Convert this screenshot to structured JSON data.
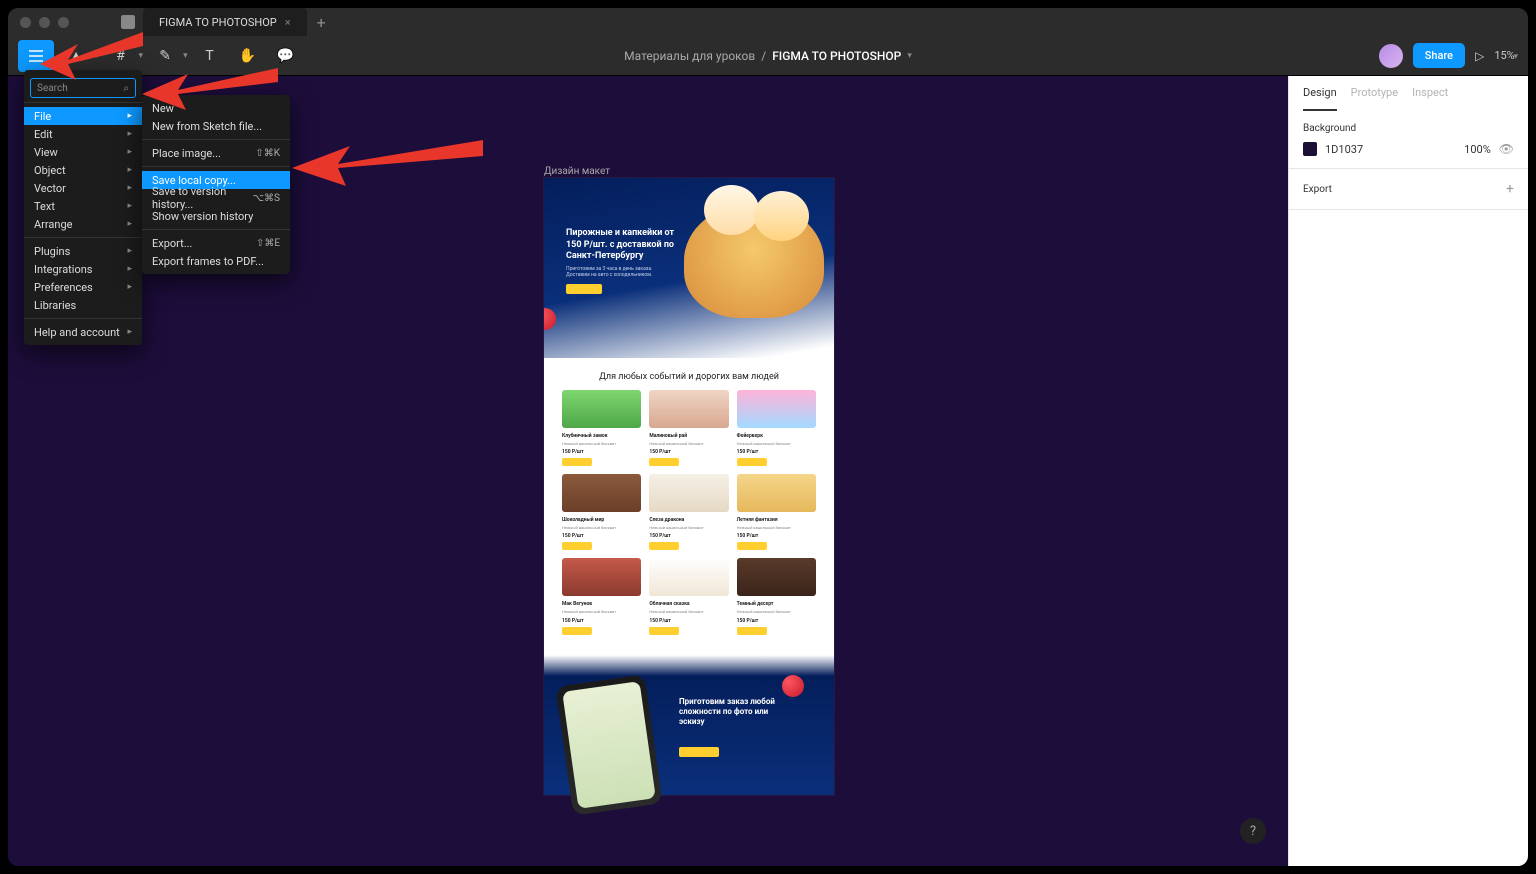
{
  "tab": {
    "title": "FIGMA TO PHOTOSHOP"
  },
  "breadcrumb": {
    "folder": "Материалы для уроков",
    "file": "FIGMA TO PHOTOSHOP"
  },
  "toolbar": {
    "share": "Share",
    "zoom": "15%"
  },
  "main_menu": {
    "search_placeholder": "Search",
    "items": [
      "File",
      "Edit",
      "View",
      "Object",
      "Vector",
      "Text",
      "Arrange"
    ],
    "items2": [
      "Plugins",
      "Integrations",
      "Preferences",
      "Libraries"
    ],
    "items3": [
      "Help and account"
    ]
  },
  "sub_menu": {
    "new": "New",
    "new_sketch": "New from Sketch file...",
    "place": "Place image...",
    "place_sc": "⇧⌘K",
    "save_local": "Save local copy...",
    "save_history": "Save to version history...",
    "save_history_sc": "⌥⌘S",
    "show_history": "Show version history",
    "export": "Export...",
    "export_sc": "⇧⌘E",
    "export_pdf": "Export frames to PDF..."
  },
  "right_panel": {
    "tabs": [
      "Design",
      "Prototype",
      "Inspect"
    ],
    "bg_label": "Background",
    "bg_hex": "1D1037",
    "bg_opacity": "100%",
    "export_label": "Export"
  },
  "canvas": {
    "frame_label": "Дизайн макет",
    "hero": {
      "title": "Пирожные и капкейки от 150 Р/шт. с доставкой по Санкт-Петербургу",
      "sub": "Приготовим за 3 часа в день заказа. Доставим на авто с холодильником."
    },
    "section_title": "Для любых событий и дорогих вам людей",
    "cards": [
      {
        "t": "Клубничный замок",
        "p": "150 Р/шт",
        "img": "linear-gradient(#7fd66f,#4ea848)"
      },
      {
        "t": "Малиновый рай",
        "p": "150 Р/шт",
        "img": "linear-gradient(#f0d4c4,#d8a890)"
      },
      {
        "t": "Фейерверк",
        "p": "150 Р/шт",
        "img": "linear-gradient(#ffb3d9,#a3d9ff)"
      },
      {
        "t": "Шоколадный мир",
        "p": "150 Р/шт",
        "img": "linear-gradient(#8b5a3c,#6b3f2a)"
      },
      {
        "t": "Слеза дракона",
        "p": "150 Р/шт",
        "img": "linear-gradient(#f5f0e6,#e6d9c4)"
      },
      {
        "t": "Летняя фантазия",
        "p": "150 Р/шт",
        "img": "linear-gradient(#f5d68a,#e6b85c)"
      },
      {
        "t": "Мак Вегунов",
        "p": "150 Р/шт",
        "img": "linear-gradient(#c45a4a,#8b3a2f)"
      },
      {
        "t": "Облачная сказка",
        "p": "150 Р/шт",
        "img": "linear-gradient(#fff,#f0e6d6)"
      },
      {
        "t": "Темный десерт",
        "p": "150 Р/шт",
        "img": "linear-gradient(#5a3a2a,#3a241a)"
      }
    ],
    "cta": {
      "title": "Приготовим заказ любой сложности по фото или эскизу"
    }
  }
}
